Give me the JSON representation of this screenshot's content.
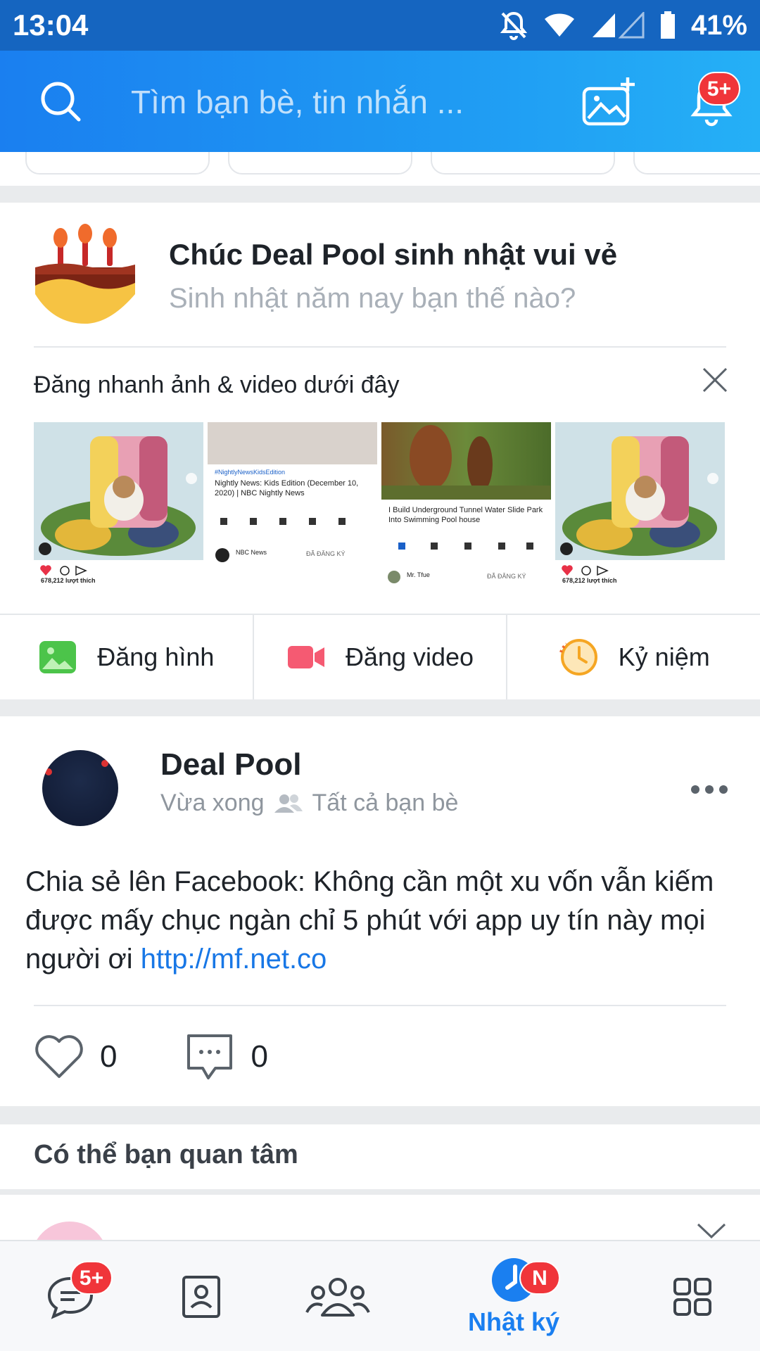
{
  "status_bar": {
    "time": "13:04",
    "battery": "41%"
  },
  "header": {
    "search_placeholder": "Tìm bạn bè, tin nhắn ...",
    "notification_badge": "5+"
  },
  "birthday": {
    "title": "Chúc Deal Pool sinh nhật vui vẻ",
    "subtitle": "Sinh nhật năm nay bạn thế nào?"
  },
  "quick_post": {
    "title": "Đăng nhanh ảnh & video dưới đây",
    "thumbnails": [
      {
        "type": "cat",
        "likes": "678,212 lượt thích"
      },
      {
        "type": "news",
        "caption": "Nightly News: Kids Edition (December 10, 2020) | NBC Nightly News",
        "tag": "#NightlyNewsKidsEdition",
        "channel": "NBC News",
        "subscribe": "ĐÃ ĐĂNG KÝ"
      },
      {
        "type": "jungle",
        "caption": "I Build Underground Tunnel Water Slide Park Into Swimming Pool house",
        "channel": "Mr. Tfue",
        "subscribe": "ĐÃ ĐĂNG KÝ"
      },
      {
        "type": "cat",
        "likes": "678,212 lượt thích"
      }
    ]
  },
  "actions": [
    {
      "label": "Đăng hình",
      "icon": "image-icon",
      "color": "#4cc44a"
    },
    {
      "label": "Đăng video",
      "icon": "video-icon",
      "color": "#f55a72"
    },
    {
      "label": "Kỷ niệm",
      "icon": "clock-icon",
      "color": "#f5a623"
    }
  ],
  "post": {
    "author": "Deal Pool",
    "time": "Vừa xong",
    "privacy": "Tất cả bạn bè",
    "text": "Chia sẻ lên Facebook: Không cần một xu vốn vẫn kiếm được mấy chục ngàn chỉ 5 phút với app uy tín này mọi người ơi ",
    "link": "http://mf.net.co",
    "likes": "0",
    "comments": "0"
  },
  "suggestions": {
    "title": "Có thể bạn quan tâm"
  },
  "bottom_nav": {
    "messages_badge": "5+",
    "timeline_label": "Nhật ký",
    "timeline_badge": "N",
    "accent": "#1a7ff0"
  }
}
